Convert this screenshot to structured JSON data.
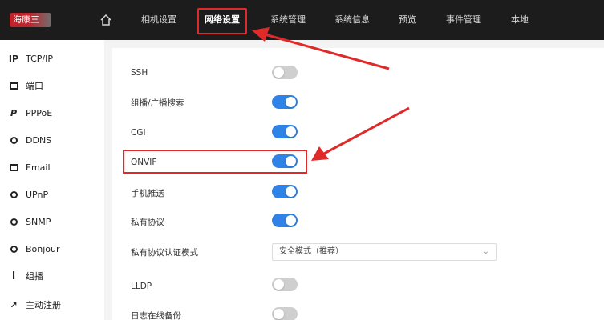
{
  "header": {
    "logo_text": "海康三",
    "nav": [
      {
        "label": "相机设置"
      },
      {
        "label": "网络设置"
      },
      {
        "label": "系统管理"
      },
      {
        "label": "系统信息"
      },
      {
        "label": "预览"
      },
      {
        "label": "事件管理"
      },
      {
        "label": "本地"
      }
    ],
    "active_tab": "网络设置"
  },
  "sidebar": {
    "items": [
      {
        "label": "TCP/IP",
        "icon": "ip-icon"
      },
      {
        "label": "端口",
        "icon": "port-icon"
      },
      {
        "label": "PPPoE",
        "icon": "pppoe-icon"
      },
      {
        "label": "DDNS",
        "icon": "ddns-icon"
      },
      {
        "label": "Email",
        "icon": "email-icon"
      },
      {
        "label": "UPnP",
        "icon": "upnp-icon"
      },
      {
        "label": "SNMP",
        "icon": "snmp-icon"
      },
      {
        "label": "Bonjour",
        "icon": "bonjour-icon"
      },
      {
        "label": "组播",
        "icon": "multicast-icon"
      },
      {
        "label": "主动注册",
        "icon": "register-icon"
      }
    ]
  },
  "settings": {
    "rows": [
      {
        "label": "SSH",
        "enabled": false
      },
      {
        "label": "组播/广播搜索",
        "enabled": true
      },
      {
        "label": "CGI",
        "enabled": true
      },
      {
        "label": "ONVIF",
        "enabled": true
      },
      {
        "label": "手机推送",
        "enabled": true
      },
      {
        "label": "私有协议",
        "enabled": true
      },
      {
        "label": "私有协议认证模式",
        "value": "安全模式（推荐）"
      },
      {
        "label": "LLDP",
        "enabled": false
      },
      {
        "label": "日志在线备份",
        "enabled": false
      }
    ]
  },
  "colors": {
    "toggle_on": "#2f83e6",
    "toggle_off": "#cfcfcf",
    "highlight": "#e02a2a",
    "header_bg": "#1c1c1c"
  }
}
